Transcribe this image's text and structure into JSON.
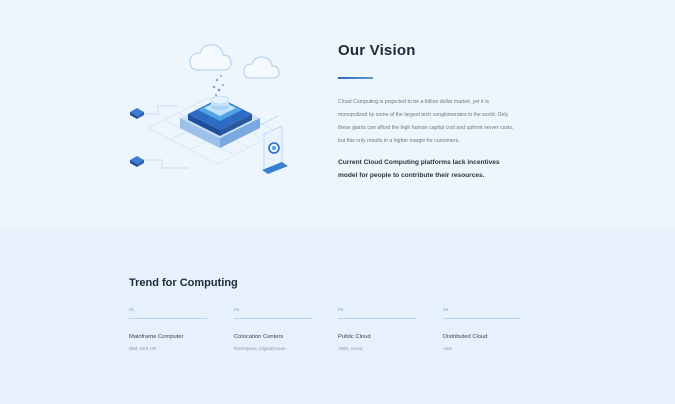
{
  "vision": {
    "title": "Our Vision",
    "paragraph_lines": [
      "Cloud Computing is projected to be a trillion dollar market, yet it is",
      "monopolized by some of the largest tech conglomerates in the world. Only",
      "these giants can afford the high human capital cost and upfront server costs,",
      "but this only results in a higher margin for customers."
    ],
    "emphasis_lines": [
      "Current Cloud Computing platforms lack incentives",
      "model for people to contribute their resources."
    ]
  },
  "trend": {
    "title": "Trend for Computing",
    "items": [
      {
        "number": "01",
        "name": "Mainframe Computer",
        "examples": "IBM, Dell, HP"
      },
      {
        "number": "02",
        "name": "Colocation Centers",
        "examples": "Rackspace, DigitalOcean"
      },
      {
        "number": "03",
        "name": "Public Cloud",
        "examples": "AWS, Azure"
      },
      {
        "number": "04",
        "name": "Distributed Cloud",
        "examples": "Aleo"
      }
    ]
  },
  "colors": {
    "accent": "#2f64b6",
    "accent_light": "#5da0dc",
    "heading": "#1f2a38",
    "body_text": "#6b7785",
    "section_bg": "#eef6fd",
    "trend_bg": "#e6f1fb"
  },
  "icons": {
    "illustration": "isometric-cloud-server-illustration",
    "cloud": "cloud-icon",
    "server_stack": "server-stack-icon",
    "shield": "shield-icon"
  }
}
